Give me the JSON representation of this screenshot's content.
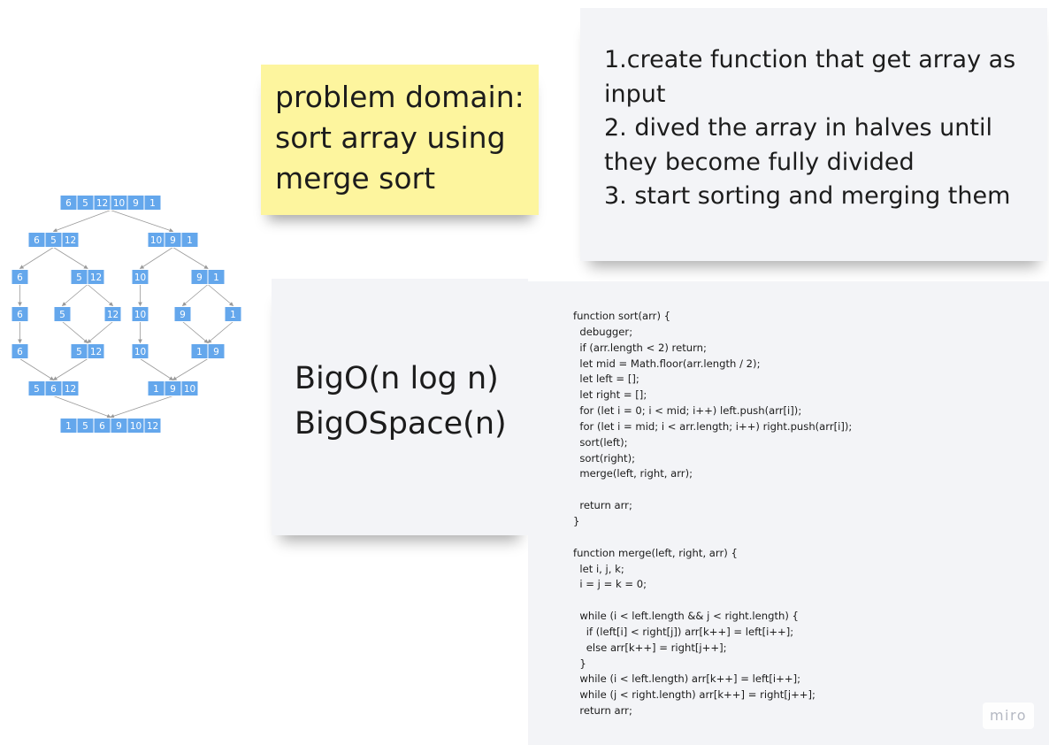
{
  "problem_note": {
    "lines": [
      "problem domain:",
      "sort array using",
      "merge sort"
    ]
  },
  "steps_note": {
    "lines": [
      "1.create function that get array as",
      "input",
      "2. dived the array in halves until",
      "they become fully divided",
      "3. start sorting and merging them"
    ]
  },
  "complexity_note": {
    "time": "BigO(n log n)",
    "space": "BigOSpace(n)"
  },
  "code_note": {
    "lines": [
      "function sort(arr) {",
      "  debugger;",
      "  if (arr.length < 2) return;",
      "  let mid = Math.floor(arr.length / 2);",
      "  let left = [];",
      "  let right = [];",
      "  for (let i = 0; i < mid; i++) left.push(arr[i]);",
      "  for (let i = mid; i < arr.length; i++) right.push(arr[i]);",
      "  sort(left);",
      "  sort(right);",
      "  merge(left, right, arr);",
      "",
      "  return arr;",
      "}",
      "",
      "function merge(left, right, arr) {",
      "  let i, j, k;",
      "  i = j = k = 0;",
      "",
      "  while (i < left.length && j < right.length) {",
      "    if (left[i] < right[j]) arr[k++] = left[i++];",
      "    else arr[k++] = right[j++];",
      "  }",
      "  while (i < left.length) arr[k++] = left[i++];",
      "  while (j < right.length) arr[k++] = right[j++];",
      "  return arr;"
    ]
  },
  "merge_tree": {
    "levels": [
      [
        [
          "6",
          "5",
          "12",
          "10",
          "9",
          "1"
        ]
      ],
      [
        [
          "6",
          "5",
          "12"
        ],
        [
          "10",
          "9",
          "1"
        ]
      ],
      [
        [
          "6"
        ],
        [
          "5",
          "12"
        ],
        [
          "10"
        ],
        [
          "9",
          "1"
        ]
      ],
      [
        [
          "6"
        ],
        [
          "5"
        ],
        [
          "12"
        ],
        [
          "10"
        ],
        [
          "9"
        ],
        [
          "1"
        ]
      ],
      [
        [
          "6"
        ],
        [
          "5",
          "12"
        ],
        [
          "10"
        ],
        [
          "1",
          "9"
        ]
      ],
      [
        [
          "5",
          "6",
          "12"
        ],
        [
          "1",
          "9",
          "10"
        ]
      ],
      [
        [
          "1",
          "5",
          "6",
          "9",
          "10",
          "12"
        ]
      ]
    ],
    "cell_color": "#64a7ec",
    "arrow_color": "#9a9a9a"
  },
  "colors": {
    "yellow_note": "#fdf59e",
    "gray_note": "#f3f4f7",
    "text": "#1c1c1c"
  },
  "watermark": "miro"
}
